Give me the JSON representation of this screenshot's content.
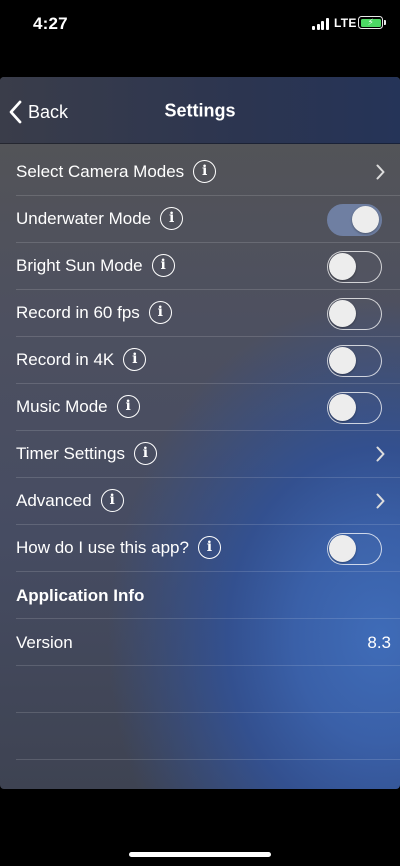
{
  "status_bar": {
    "time": "4:27",
    "network": "LTE",
    "battery_charging": true,
    "battery_color": "#4cd964"
  },
  "navbar": {
    "back_label": "Back",
    "title": "Settings"
  },
  "rows": [
    {
      "label": "Select Camera Modes",
      "info": true,
      "control": "chevron"
    },
    {
      "label": "Underwater Mode",
      "info": true,
      "control": "toggle",
      "on": true
    },
    {
      "label": "Bright Sun Mode",
      "info": true,
      "control": "toggle",
      "on": false
    },
    {
      "label": "Record in 60 fps",
      "info": true,
      "control": "toggle",
      "on": false
    },
    {
      "label": "Record in 4K",
      "info": true,
      "control": "toggle",
      "on": false
    },
    {
      "label": "Music Mode",
      "info": true,
      "control": "toggle",
      "on": false
    },
    {
      "label": "Timer Settings",
      "info": true,
      "control": "chevron"
    },
    {
      "label": "Advanced",
      "info": true,
      "control": "chevron"
    },
    {
      "label": "How do I use this app?",
      "info": true,
      "control": "toggle",
      "on": false
    }
  ],
  "info_glyph": "i",
  "section": {
    "title": "Application Info",
    "version_label": "Version",
    "version_value": "8.3"
  },
  "colors": {
    "toggle_on": "#6f7fa2",
    "accent_blue": "#3f6cb8"
  }
}
